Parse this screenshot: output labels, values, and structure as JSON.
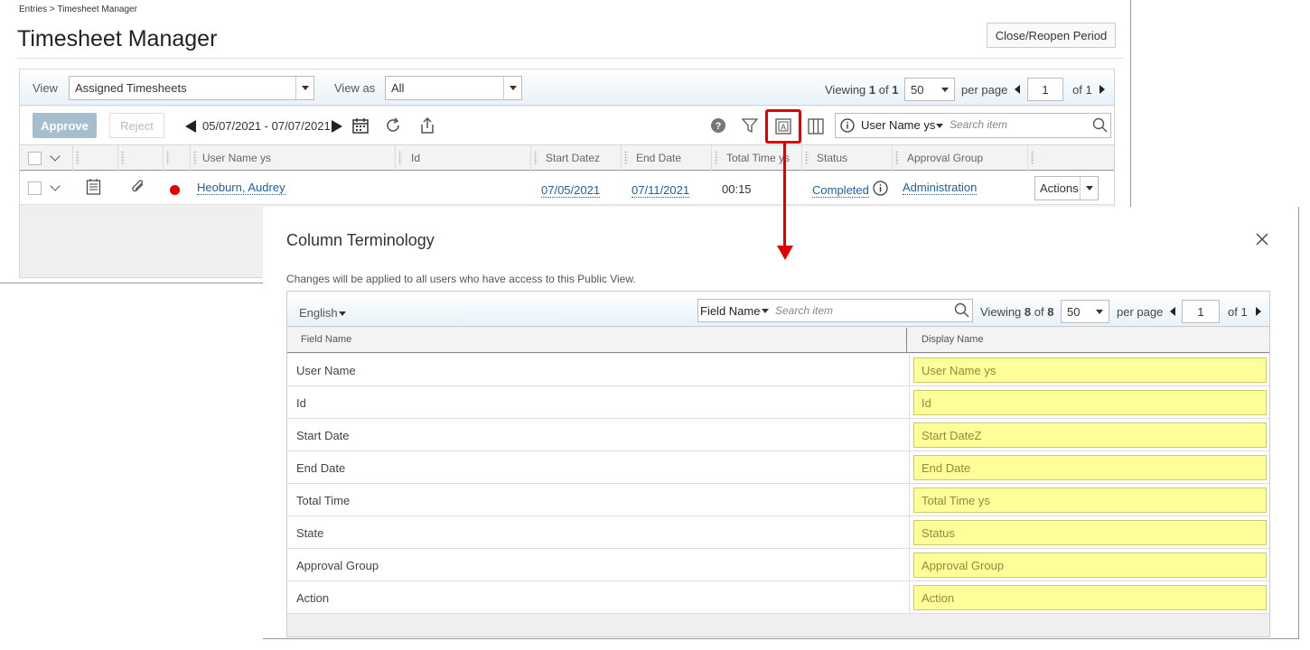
{
  "breadcrumb": "Entries > Timesheet Manager",
  "page_title": "Timesheet Manager",
  "close_reopen_label": "Close/Reopen Period",
  "view_label": "View",
  "view_value": "Assigned Timesheets",
  "view_as_label": "View as",
  "view_as_value": "All",
  "paging": {
    "viewing": "Viewing",
    "current": "1",
    "of_word": "of",
    "total": "1",
    "per_page_value": "50",
    "per_page_label": "per page",
    "page": "1",
    "of_pages": "of 1"
  },
  "toolbar": {
    "approve": "Approve",
    "reject": "Reject",
    "date_range": "05/07/2021 - 07/07/2021"
  },
  "search": {
    "field": "User Name ys",
    "placeholder": "Search item"
  },
  "columns": [
    "User Name ys",
    "Id",
    "Start Datez",
    "End Date",
    "Total Time ys",
    "Status",
    "Approval Group"
  ],
  "row": {
    "user": "Heoburn, Audrey",
    "start": "07/05/2021",
    "end": "07/11/2021",
    "total": "00:15",
    "status": "Completed",
    "group": "Administration",
    "actions": "Actions"
  },
  "dialog": {
    "title": "Column Terminology",
    "note": "Changes will be applied to all users who have access to this Public View.",
    "language": "English",
    "search_field": "Field Name",
    "search_placeholder": "Search item",
    "viewing": "Viewing",
    "current": "8",
    "of_word": "of",
    "total": "8",
    "per_page_value": "50",
    "per_page_label": "per page",
    "page": "1",
    "of_pages": "of 1",
    "col_field": "Field Name",
    "col_display": "Display Name",
    "rows": [
      {
        "field": "User Name",
        "display": "User Name ys"
      },
      {
        "field": "Id",
        "display": "Id"
      },
      {
        "field": "Start Date",
        "display": "Start DateZ"
      },
      {
        "field": "End Date",
        "display": "End Date"
      },
      {
        "field": "Total Time",
        "display": "Total Time ys"
      },
      {
        "field": "State",
        "display": "Status"
      },
      {
        "field": "Approval Group",
        "display": "Approval Group"
      },
      {
        "field": "Action",
        "display": "Action"
      }
    ]
  },
  "colors": {
    "accent_red": "#e00000",
    "link": "#1f5f9e",
    "highlight": "#ffff99"
  }
}
